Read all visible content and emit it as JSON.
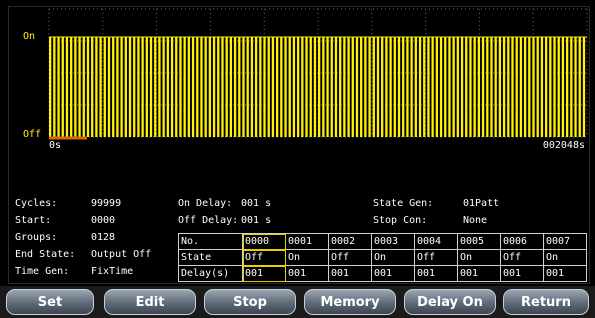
{
  "colors": {
    "accent": "#fff200",
    "marker": "#d86a00",
    "grid": "#6a6a6a"
  },
  "plot": {
    "y_top_label": "On",
    "y_bottom_label": "Off",
    "x_start_label": "0s",
    "x_end_label": "002048s"
  },
  "info": {
    "cycles_label": "Cycles:",
    "cycles_value": "99999",
    "start_label": "Start:",
    "start_value": "0000",
    "groups_label": "Groups:",
    "groups_value": "0128",
    "end_state_label": "End State:",
    "end_state_value": "Output Off",
    "time_gen_label": "Time Gen:",
    "time_gen_value": "FixTime",
    "on_delay_label": "On Delay:",
    "on_delay_value": "001 s",
    "off_delay_label": "Off Delay:",
    "off_delay_value": "001 s",
    "state_gen_label": "State Gen:",
    "state_gen_value": "01Patt",
    "stop_con_label": "Stop Con:",
    "stop_con_value": "None"
  },
  "table": {
    "row_labels": [
      "No.",
      "State",
      "Delay(s)"
    ],
    "no": [
      "0000",
      "0001",
      "0002",
      "0003",
      "0004",
      "0005",
      "0006",
      "0007"
    ],
    "state": [
      "Off",
      "On",
      "Off",
      "On",
      "Off",
      "On",
      "Off",
      "On"
    ],
    "delay": [
      "001",
      "001",
      "001",
      "001",
      "001",
      "001",
      "001",
      "001"
    ]
  },
  "softkeys": [
    "Set",
    "Edit",
    "Stop",
    "Memory",
    "Delay On",
    "Return"
  ]
}
